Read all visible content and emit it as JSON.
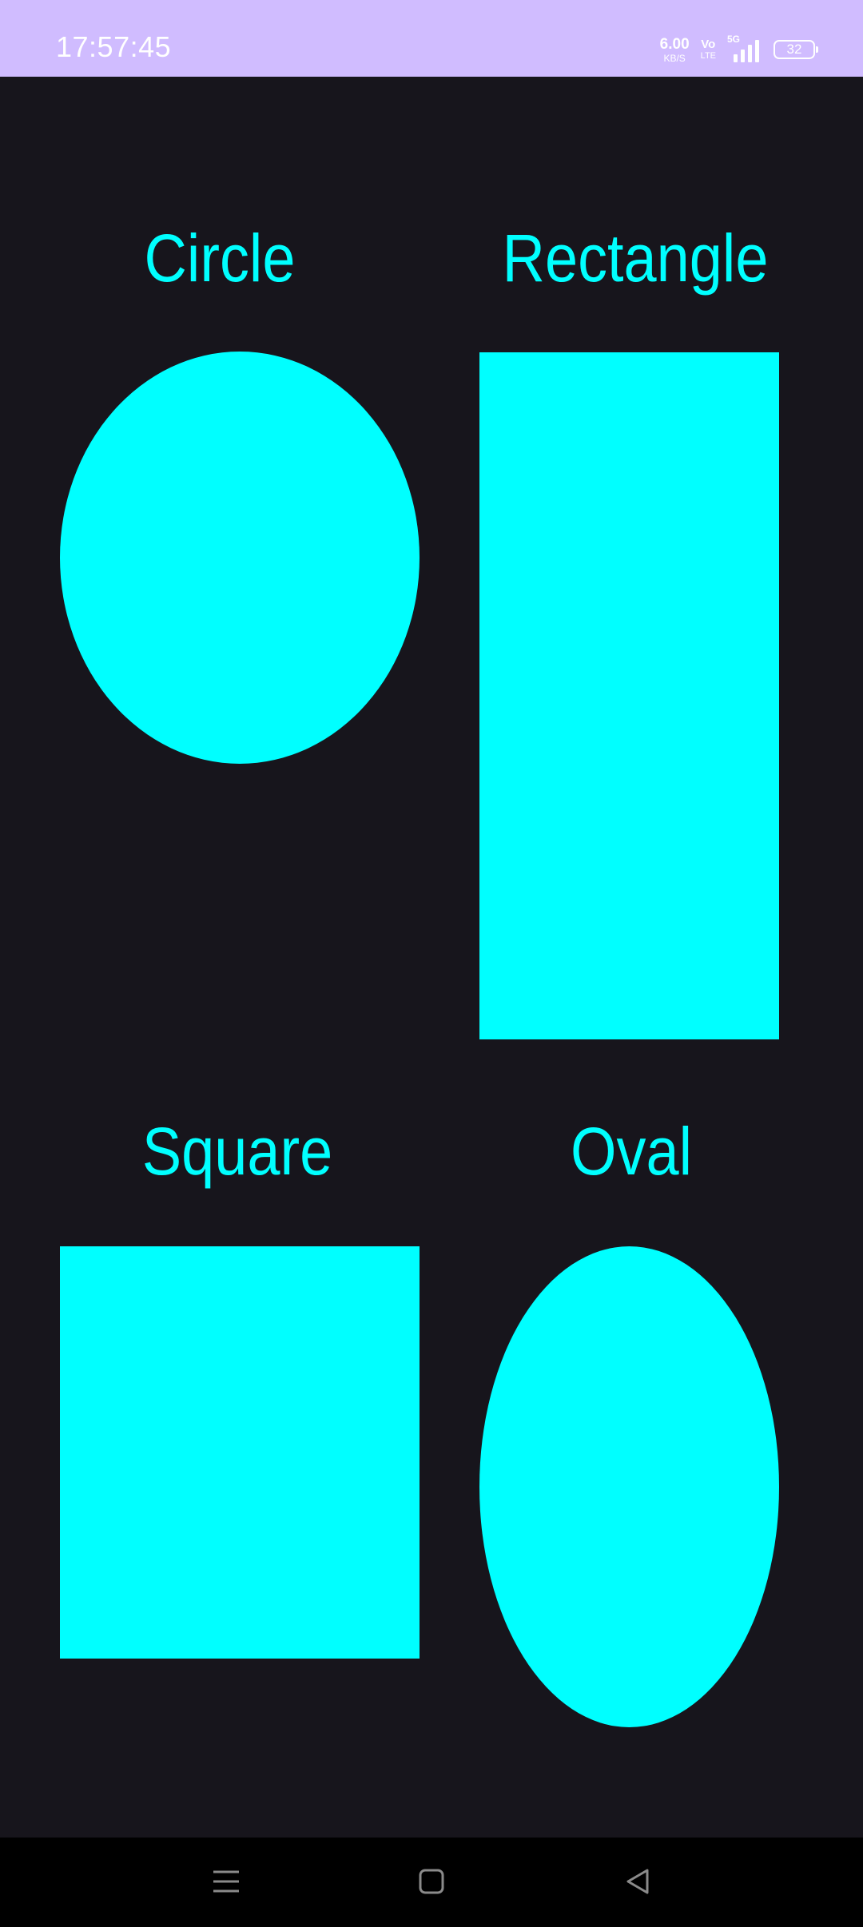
{
  "status_bar": {
    "time": "17:57:45",
    "net_speed_value": "6.00",
    "net_speed_unit": "KB/S",
    "volte_top": "Vo",
    "volte_bottom": "LTE",
    "network_type": "5G",
    "battery_level": "32",
    "background_color": "#d0bcff"
  },
  "shapes": {
    "circle_label": "Circle",
    "rectangle_label": "Rectangle",
    "square_label": "Square",
    "oval_label": "Oval",
    "fill_color": "#00ffff",
    "background_color": "#17151c"
  },
  "nav_bar": {
    "menu_icon": "menu-icon",
    "home_icon": "home-icon",
    "back_icon": "back-icon"
  }
}
